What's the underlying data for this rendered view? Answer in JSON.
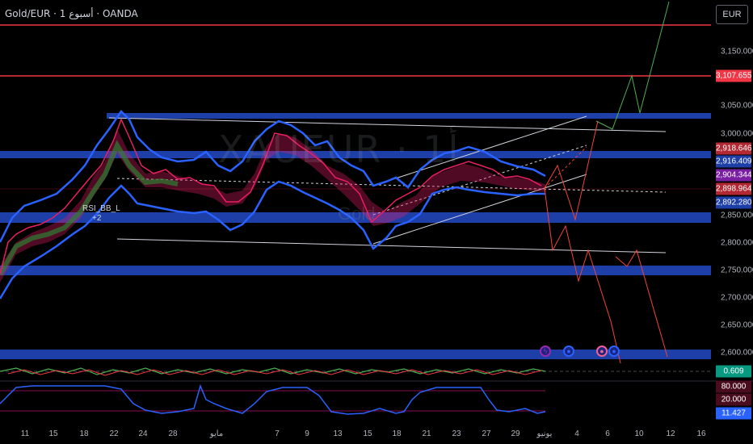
{
  "header": {
    "ticker": "Gold/EUR · 1 أسبوع · OANDA",
    "currency": "EUR"
  },
  "watermark": {
    "symbol": "XAUEUR · 1أ",
    "name": "Gold"
  },
  "indicator": {
    "name": "RSI_BB_L",
    "value": "+2"
  },
  "price_ticks": [
    "3,150.000",
    "3,050.000",
    "3,000.000",
    "2,850.000",
    "2,800.000",
    "2,750.000",
    "2,700.000",
    "2,650.000",
    "2,600.000"
  ],
  "price_labels": [
    {
      "text": "3,107.655",
      "color": "#f23645"
    },
    {
      "text": "2,918.646",
      "color": "#b22833"
    },
    {
      "text": "2,916.409",
      "color": "#1e3ea8"
    },
    {
      "text": "2,904.344",
      "color": "#7b1fa2"
    },
    {
      "text": "2,898.964",
      "color": "#b22833"
    },
    {
      "text": "2,892.280",
      "color": "#1e3ea8"
    }
  ],
  "oscillator_labels": [
    {
      "text": "0.609",
      "color": "#089981"
    },
    {
      "text": "80.000",
      "color": "#4a0d1e"
    },
    {
      "text": "20.000",
      "color": "#4a0d1e"
    },
    {
      "text": "11.427",
      "color": "#2962ff"
    }
  ],
  "time_ticks": [
    "11",
    "15",
    "18",
    "22",
    "24",
    "28",
    "مايو",
    "7",
    "9",
    "13",
    "15",
    "18",
    "21",
    "23",
    "27",
    "29",
    "يونيو",
    "4",
    "6",
    "10",
    "12",
    "16"
  ],
  "markers": [
    {
      "symbol": "ϟ",
      "color": "#9c27b0"
    },
    {
      "symbol": "●",
      "color": "#2962ff"
    },
    {
      "symbol": "●",
      "color": "#f06292"
    },
    {
      "symbol": "●",
      "color": "#2962ff"
    }
  ],
  "colors": {
    "background": "#000000",
    "zone": "#1e3ea8",
    "resistance_line": "#f23645",
    "bb_band": "#2962ff",
    "bull_projection": "#4caf50",
    "bear_projection": "#f44336",
    "channel": "#d1d4dc"
  }
}
